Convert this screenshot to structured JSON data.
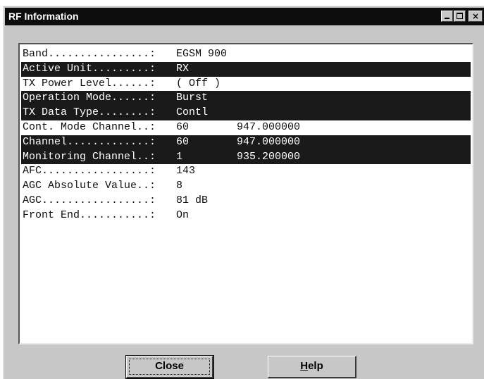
{
  "window": {
    "title": "RF Information",
    "controls": {
      "minimize_icon": "minimize-icon",
      "maximize_icon": "maximize-icon",
      "close_glyph": "×"
    }
  },
  "rf_rows": [
    {
      "label": "Band................:",
      "value": "EGSM 900",
      "value2": "",
      "highlighted": false
    },
    {
      "label": "Active Unit.........:",
      "value": "RX",
      "value2": "",
      "highlighted": true
    },
    {
      "label": "TX Power Level......:",
      "value": "( Off )",
      "value2": "",
      "highlighted": false
    },
    {
      "label": "Operation Mode......:",
      "value": "Burst",
      "value2": "",
      "highlighted": true
    },
    {
      "label": "TX Data Type........:",
      "value": "Contl",
      "value2": "",
      "highlighted": true
    },
    {
      "label": "Cont. Mode Channel..:",
      "value": "60",
      "value2": "947.000000",
      "highlighted": false
    },
    {
      "label": "Channel.............:",
      "value": "60",
      "value2": "947.000000",
      "highlighted": true
    },
    {
      "label": "Monitoring Channel..:",
      "value": "1",
      "value2": "935.200000",
      "highlighted": true
    },
    {
      "label": "AFC.................:",
      "value": "143",
      "value2": "",
      "highlighted": false
    },
    {
      "label": "AGC Absolute Value..:",
      "value": "8",
      "value2": "",
      "highlighted": false
    },
    {
      "label": "AGC.................:",
      "value": "81 dB",
      "value2": "",
      "highlighted": false
    },
    {
      "label": "Front End...........:",
      "value": "On",
      "value2": "",
      "highlighted": false
    }
  ],
  "buttons": {
    "close_label": "Close",
    "help_label_mnemonic": "H",
    "help_label_rest": "elp"
  },
  "colors": {
    "highlight_bg": "#1a1a1a",
    "titlebar_bg": "#0d0d0d",
    "dialog_bg": "#c7c7c7"
  }
}
